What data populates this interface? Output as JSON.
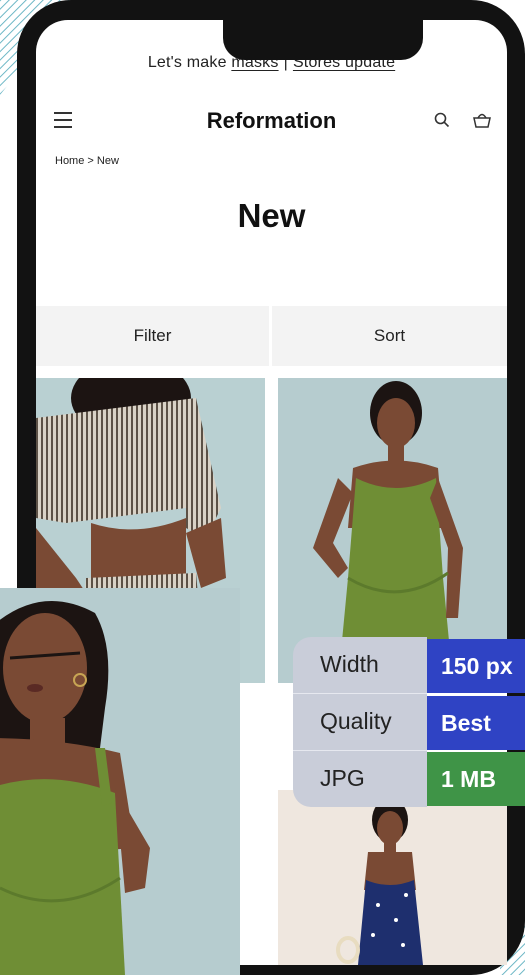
{
  "promo": {
    "prefix": "Let's make ",
    "link1": "masks",
    "separator": "|",
    "link2": "Stores update"
  },
  "header": {
    "brand": "Reformation"
  },
  "breadcrumb": "Home > New",
  "page_title": "New",
  "filter_bar": {
    "filter_label": "Filter",
    "sort_label": "Sort"
  },
  "badges": {
    "rows": [
      {
        "label": "Width",
        "value": "150 px",
        "color": "#2f43c4"
      },
      {
        "label": "Quality",
        "value": "Best",
        "color": "#2f43c4"
      },
      {
        "label": "JPG",
        "value": "1 MB",
        "color": "#3f9447"
      }
    ]
  },
  "colors": {
    "photo_bg": "#b6cccf",
    "dress": "#6f8e35",
    "navy_dress": "#1e2f6e",
    "badge_bg": "#c9cdd9"
  },
  "icons": [
    "menu-icon",
    "search-icon",
    "bag-icon"
  ]
}
